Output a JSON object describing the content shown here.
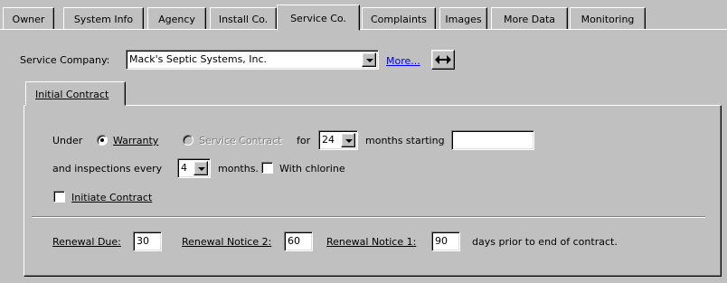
{
  "tabs": [
    {
      "label": "Owner",
      "active": false
    },
    {
      "label": "System Info",
      "active": false
    },
    {
      "label": "Agency",
      "active": false
    },
    {
      "label": "Install Co.",
      "active": false
    },
    {
      "label": "Service Co.",
      "active": true
    },
    {
      "label": "Complaints",
      "active": false
    },
    {
      "label": "Images",
      "active": false
    },
    {
      "label": "More Data",
      "active": false
    },
    {
      "label": "Monitoring",
      "active": false
    }
  ],
  "service_company": {
    "label": "Service Company:",
    "value": "Mack's Septic Systems, Inc.",
    "more_link": "More...",
    "swap_icon": "left-right-arrow-icon"
  },
  "contract_tab": {
    "label": "Initial Contract"
  },
  "contract": {
    "under_label": "Under",
    "warranty_label": "Warranty",
    "warranty_selected": true,
    "service_contract_label": "Service Contract",
    "service_contract_enabled": false,
    "for_label": "for",
    "months_value": "24",
    "months_starting_label": "months starting",
    "start_date_value": "",
    "inspections_label": "and inspections every",
    "inspection_interval_value": "4",
    "months_label": "months.",
    "with_chlorine_label": "With chlorine",
    "with_chlorine_checked": false,
    "initiate_label": "Initiate Contract",
    "initiate_checked": false
  },
  "renewal": {
    "due_label": "Renewal Due:",
    "due_value": "30",
    "notice2_label": "Renewal Notice 2:",
    "notice2_value": "60",
    "notice1_label": "Renewal Notice 1:",
    "notice1_value": "90",
    "suffix": "days prior to end of contract."
  },
  "colors": {
    "face": "#c0c0c0",
    "link": "#0000ff"
  }
}
